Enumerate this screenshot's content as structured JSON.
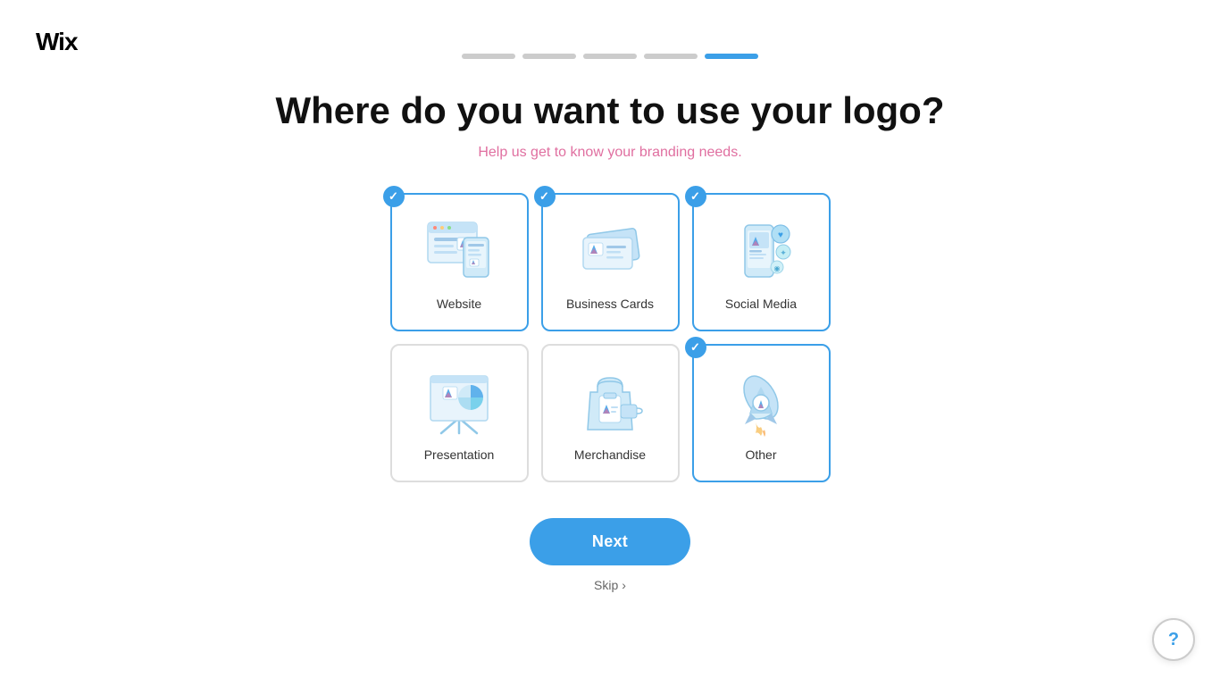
{
  "logo": {
    "text": "Wix"
  },
  "progress": {
    "segments": [
      {
        "id": 1,
        "active": false
      },
      {
        "id": 2,
        "active": false
      },
      {
        "id": 3,
        "active": false
      },
      {
        "id": 4,
        "active": false
      },
      {
        "id": 5,
        "active": true
      }
    ]
  },
  "header": {
    "title": "Where do you want to use your logo?",
    "subtitle": "Help us get to know your branding needs."
  },
  "cards": [
    {
      "id": "website",
      "label": "Website",
      "selected": true
    },
    {
      "id": "business-cards",
      "label": "Business Cards",
      "selected": true
    },
    {
      "id": "social-media",
      "label": "Social Media",
      "selected": true
    },
    {
      "id": "presentation",
      "label": "Presentation",
      "selected": false
    },
    {
      "id": "merchandise",
      "label": "Merchandise",
      "selected": false
    },
    {
      "id": "other",
      "label": "Other",
      "selected": true
    }
  ],
  "buttons": {
    "next_label": "Next",
    "skip_label": "Skip",
    "help_label": "?"
  }
}
